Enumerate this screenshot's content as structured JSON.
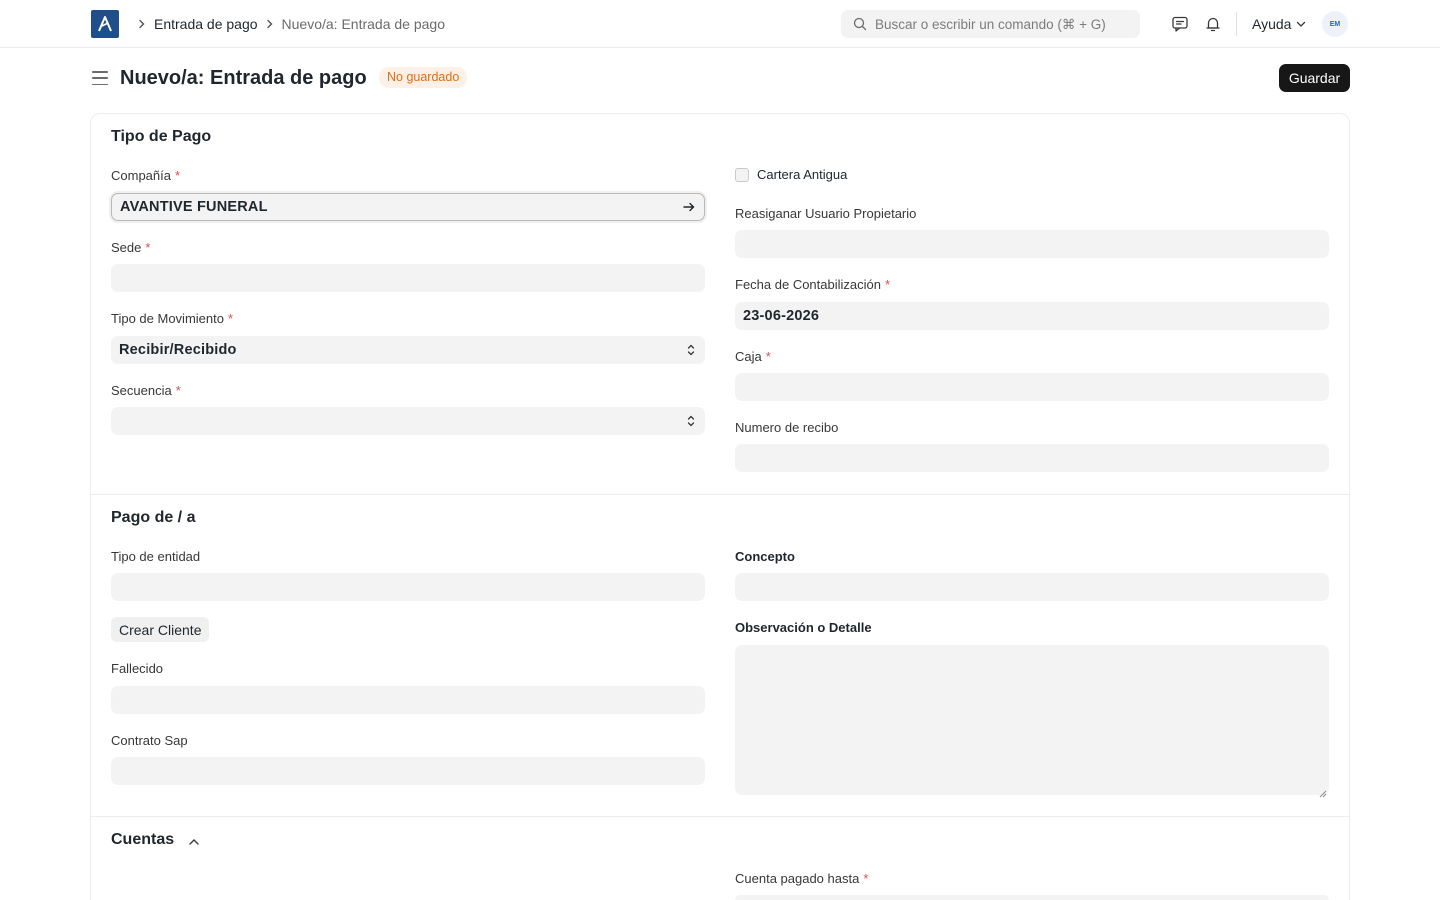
{
  "navbar": {
    "breadcrumbs": [
      "Entrada de pago",
      "Nuevo/a: Entrada de pago"
    ],
    "search_placeholder": "Buscar o escribir un comando (⌘ + G)",
    "help_label": "Ayuda",
    "avatar_text": "EM"
  },
  "page": {
    "title": "Nuevo/a: Entrada de pago",
    "status": "No guardado",
    "save_label": "Guardar"
  },
  "sections": {
    "tipo_pago": {
      "title": "Tipo de Pago",
      "compania": {
        "label": "Compañía",
        "value": "AVANTIVE FUNERAL"
      },
      "sede": {
        "label": "Sede",
        "value": ""
      },
      "tipo_movimiento": {
        "label": "Tipo de Movimiento",
        "value": "Recibir/Recibido"
      },
      "secuencia": {
        "label": "Secuencia",
        "value": ""
      },
      "cartera_antigua": {
        "label": "Cartera Antigua",
        "checked": false
      },
      "reasignar_usuario": {
        "label": "Reasiganar Usuario Propietario",
        "value": ""
      },
      "fecha_contabilizacion": {
        "label": "Fecha de Contabilización",
        "value": "23-06-2026"
      },
      "caja": {
        "label": "Caja",
        "value": ""
      },
      "numero_recibo": {
        "label": "Numero de recibo",
        "value": ""
      }
    },
    "pago_de": {
      "title": "Pago de / a",
      "tipo_entidad": {
        "label": "Tipo de entidad",
        "value": ""
      },
      "crear_cliente_label": "Crear Cliente",
      "fallecido": {
        "label": "Fallecido",
        "value": ""
      },
      "contrato_sap": {
        "label": "Contrato Sap",
        "value": ""
      },
      "concepto": {
        "label": "Concepto",
        "value": ""
      },
      "observacion": {
        "label": "Observación o Detalle",
        "value": ""
      }
    },
    "cuentas": {
      "title": "Cuentas",
      "cuenta_pagado_hasta": {
        "label": "Cuenta pagado hasta"
      }
    }
  },
  "colors": {
    "brand": "#1f4e8c",
    "primary_button": "#171717",
    "status_badge_bg": "#fdf1e7",
    "status_badge_text": "#e86c13",
    "required_marker": "#e24c4c",
    "field_bg": "#f3f3f3"
  },
  "icons": [
    "app-logo-icon",
    "chevron-right-icon",
    "search-icon",
    "chat-icon",
    "bell-icon",
    "chevron-down-icon",
    "hamburger-icon",
    "arrow-right-icon",
    "select-updown-icon",
    "chevron-up-icon"
  ]
}
